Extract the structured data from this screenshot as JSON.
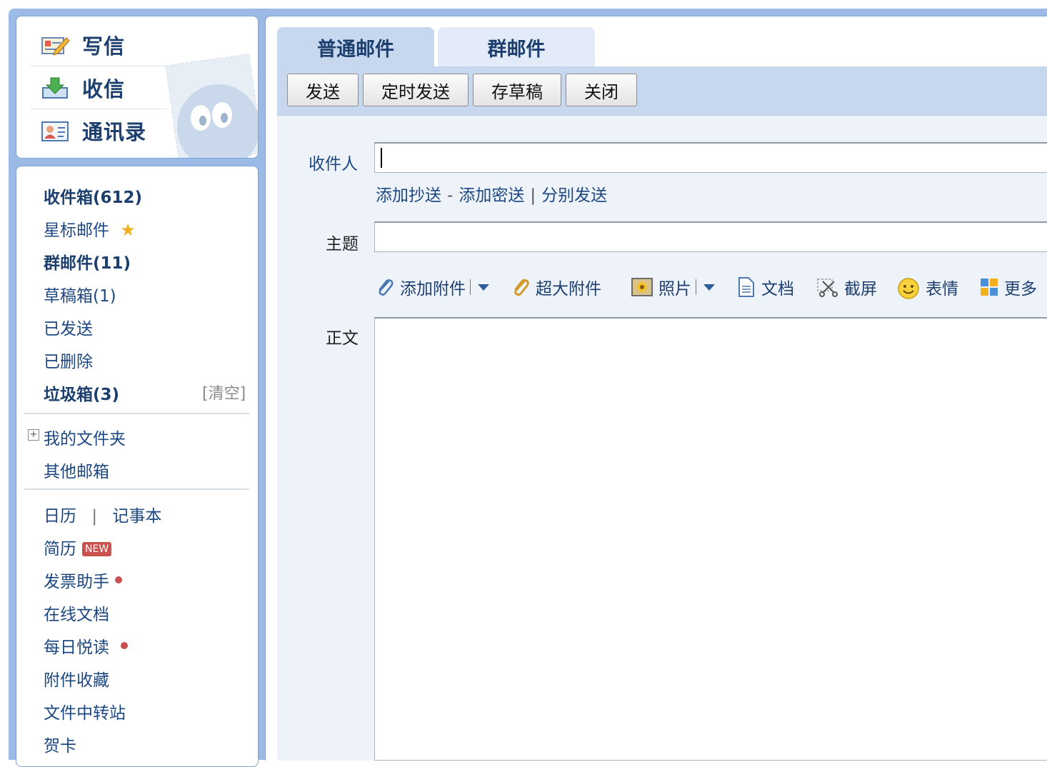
{
  "quick_actions": [
    {
      "label": "写信",
      "icon": "compose-icon"
    },
    {
      "label": "收信",
      "icon": "inbox-download-icon"
    },
    {
      "label": "通讯录",
      "icon": "contacts-icon"
    }
  ],
  "folders": {
    "inbox": "收件箱(612)",
    "starred": "星标邮件",
    "group_mail": "群邮件(11)",
    "drafts": "草稿箱(1)",
    "sent": "已发送",
    "deleted": "已删除",
    "spam": "垃圾箱(3)",
    "spam_clear": "[清空]",
    "my_folders": "我的文件夹",
    "other_mailboxes": "其他邮箱"
  },
  "tools": {
    "calendar": "日历",
    "separator": "|",
    "notebook": "记事本",
    "resume": "简历",
    "resume_badge": "NEW",
    "invoice": "发票助手",
    "online_docs": "在线文档",
    "daily_read": "每日悦读",
    "attachments": "附件收藏",
    "file_transfer": "文件中转站",
    "greeting_card": "贺卡"
  },
  "tabs": {
    "normal": "普通邮件",
    "group": "群邮件"
  },
  "toolbar": {
    "send": "发送",
    "scheduled_send": "定时发送",
    "save_draft": "存草稿",
    "close": "关闭"
  },
  "compose": {
    "to_label": "收件人",
    "to_value": "",
    "add_cc": "添加抄送",
    "dash": "-",
    "add_bcc": "添加密送",
    "pipe": "|",
    "send_separately": "分别发送",
    "subject_label": "主题",
    "subject_value": "",
    "body_label": "正文",
    "body_value": ""
  },
  "attach_bar": {
    "add_attachment": "添加附件",
    "large_attachment": "超大附件",
    "photo": "照片",
    "document": "文档",
    "screenshot": "截屏",
    "emoji": "表情",
    "more": "更多"
  },
  "colors": {
    "frame": "#9bbbe6",
    "tab_active": "#c7d8ee",
    "tab_inactive": "#e2ebf7",
    "link": "#1d4780",
    "badge_new": "#c9514e",
    "dot": "#c95050",
    "star": "#f2b01e"
  }
}
